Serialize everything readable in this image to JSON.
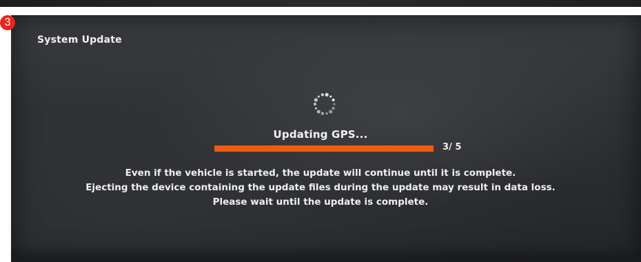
{
  "badge": {
    "label": "3",
    "color": "#e8271c"
  },
  "header": {
    "title": "System Update"
  },
  "update": {
    "status": "Updating GPS...",
    "progress": {
      "current": 3,
      "total": 5,
      "label": "3/ 5",
      "fill_fraction": 1.0,
      "color": "#f25a12"
    },
    "spinner_icon": "loading-spinner-icon"
  },
  "message": {
    "line1": "Even if the vehicle is started, the update will continue until it is complete.",
    "line2": "Ejecting the device containing the update files during the update may result in data loss.",
    "line3": "Please wait until the update is complete."
  }
}
